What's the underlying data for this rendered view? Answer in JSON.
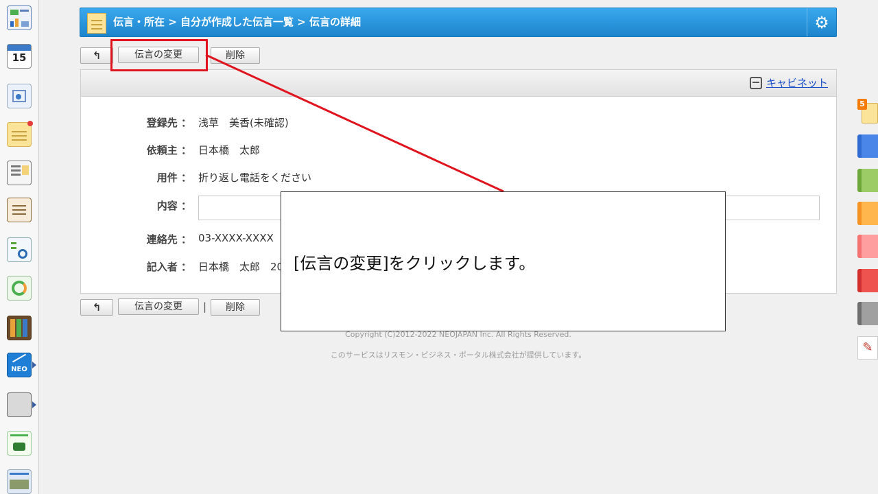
{
  "header": {
    "breadcrumb": "伝言・所在 > 自分が作成した伝言一覧 > 伝言の詳細",
    "icon": "memo-icon",
    "settings_icon": "gear-icon"
  },
  "toolbar_top": {
    "back_icon": "↰",
    "change_label": "伝言の変更",
    "delete_label": "削除"
  },
  "toolbar_bottom": {
    "back_icon": "↰",
    "change_label": "伝言の変更",
    "separator": "|",
    "delete_label": "削除"
  },
  "panel": {
    "cabinet_link": "キャビネット",
    "fields": [
      {
        "label": "登録先 ：",
        "value": "浅草　美香(未確認)"
      },
      {
        "label": "依頼主 ：",
        "value": "日本橋　太郎"
      },
      {
        "label": "用件 ：",
        "value": "折り返し電話をください"
      },
      {
        "label": "内容 ：",
        "value": ""
      },
      {
        "label": "連絡先 ：",
        "value": "03-XXXX-XXXX"
      },
      {
        "label": "記入者 ：",
        "value": "日本橋　太郎　20"
      }
    ]
  },
  "footer": {
    "copyright": "Copyright (C)2012-2022 NEOJAPAN Inc. All Rights Reserved.",
    "provider": "このサービスはリスモン・ビジネス・ポータル株式会社が提供しています。"
  },
  "annotation": {
    "text": "[伝言の変更]をクリックします。",
    "highlight_color": "#e0141e"
  },
  "leftbar": {
    "calendar_day": "15",
    "neo_label": "NEO",
    "icons": [
      "portal-icon",
      "calendar-icon",
      "workflow-icon",
      "memo-icon",
      "bulletin-icon",
      "report-icon",
      "todo-icon",
      "sync-icon",
      "cabinet-icon",
      "neo-icon",
      "folder-icon",
      "app-icon",
      "banner-icon"
    ]
  },
  "rightrail": {
    "badge_count": "5",
    "tabs": [
      "#4a86e8",
      "#8bc34a",
      "#ffa726",
      "#ff8a8a",
      "#e53935",
      "#8c8c8c"
    ]
  }
}
